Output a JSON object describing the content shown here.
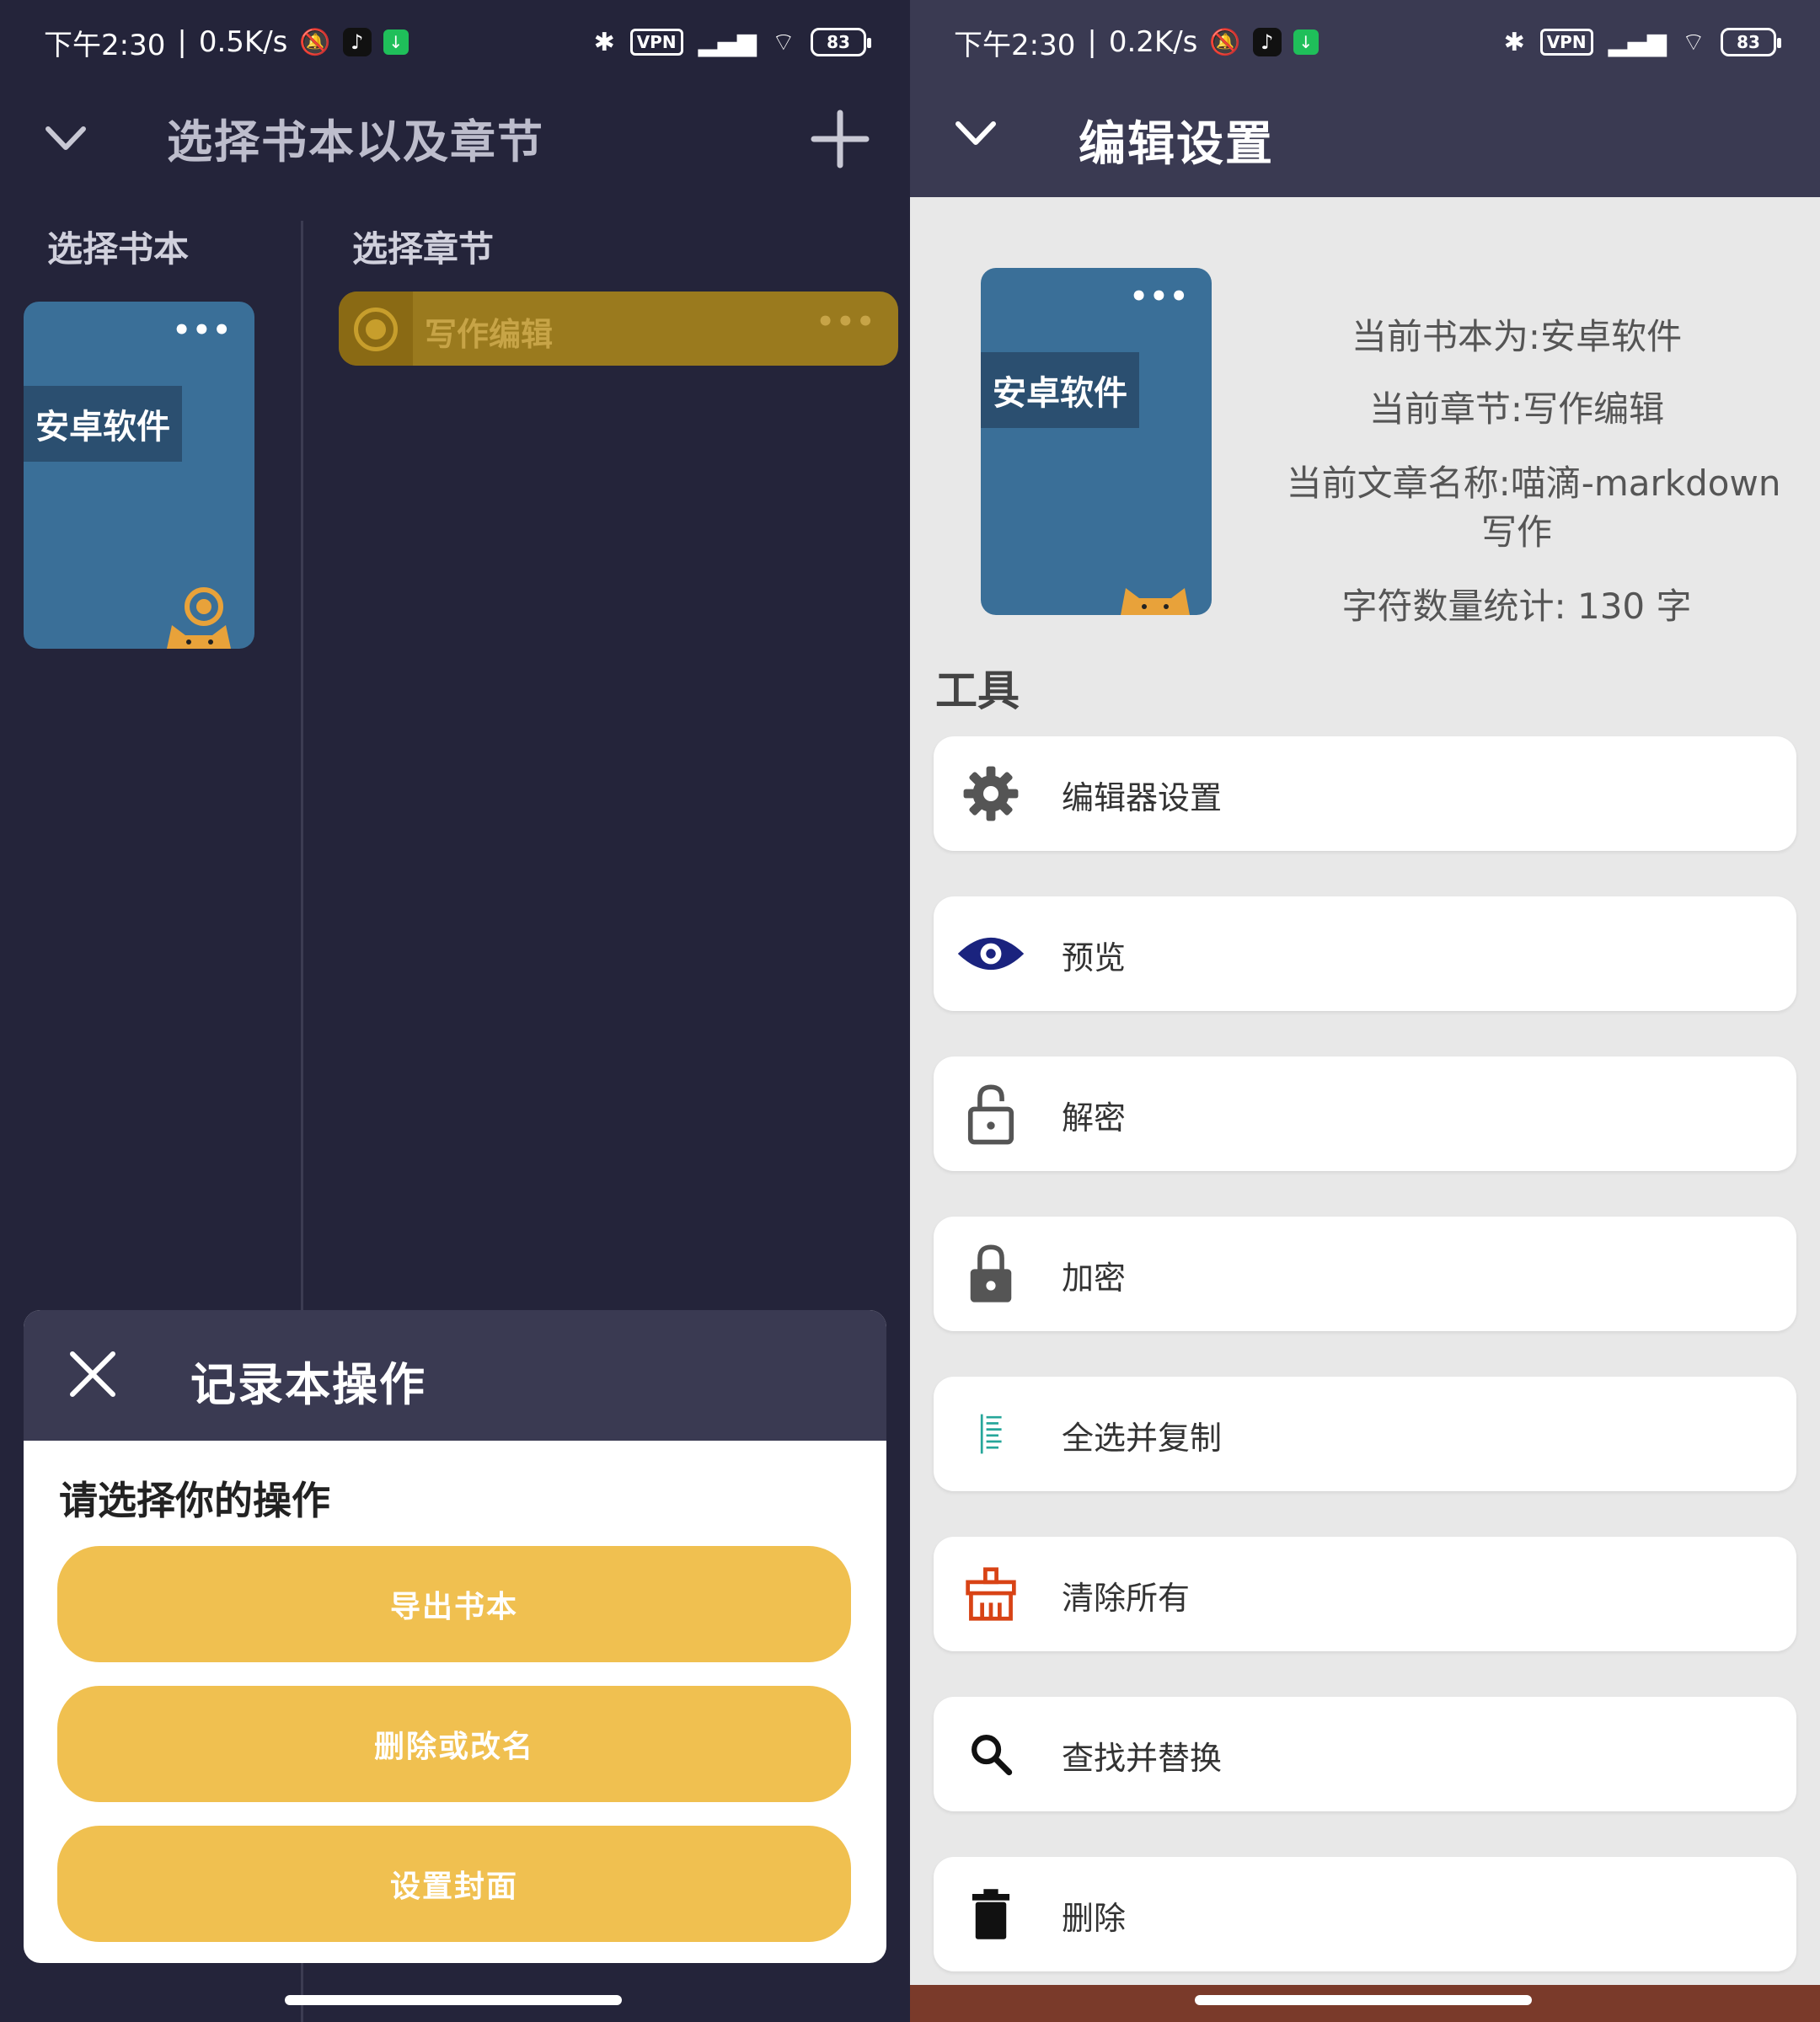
{
  "left": {
    "status": {
      "time": "下午2:30",
      "speed": "0.5K/s",
      "vpn": "VPN",
      "battery": "83"
    },
    "header": {
      "title": "选择书本以及章节"
    },
    "books_column_title": "选择书本",
    "chapters_column_title": "选择章节",
    "book": {
      "title": "安卓软件",
      "more": "•••"
    },
    "chapter": {
      "title": "写作编辑",
      "more": "•••"
    },
    "sheet": {
      "title": "记录本操作",
      "subtitle": "请选择你的操作",
      "buttons": [
        "导出书本",
        "删除或改名",
        "设置封面"
      ]
    }
  },
  "right": {
    "status": {
      "time": "下午2:30",
      "speed": "0.2K/s",
      "vpn": "VPN",
      "battery": "83"
    },
    "header": {
      "title": "编辑设置"
    },
    "cover": {
      "title": "安卓软件",
      "more": "•••"
    },
    "info": {
      "book": "当前书本为:安卓软件",
      "chapter": "当前章节:写作编辑",
      "article_line1": "当前文章名称:喵滴-markdown",
      "article_line2": "写作",
      "char_count": "字符数量统计: 130 字"
    },
    "tools_title": "工具",
    "tools": [
      {
        "label": "编辑器设置",
        "icon": "gear-icon",
        "color": "#555555"
      },
      {
        "label": "预览",
        "icon": "eye-icon",
        "color": "#1a237e"
      },
      {
        "label": "解密",
        "icon": "unlock-icon",
        "color": "#555555"
      },
      {
        "label": "加密",
        "icon": "lock-icon",
        "color": "#555555"
      },
      {
        "label": "全选并复制",
        "icon": "select-all-icon",
        "color": "#26a69a"
      },
      {
        "label": "清除所有",
        "icon": "broom-icon",
        "color": "#d84315"
      },
      {
        "label": "查找并替换",
        "icon": "search-icon",
        "color": "#111111"
      },
      {
        "label": "删除",
        "icon": "trash-icon",
        "color": "#111111"
      }
    ]
  }
}
